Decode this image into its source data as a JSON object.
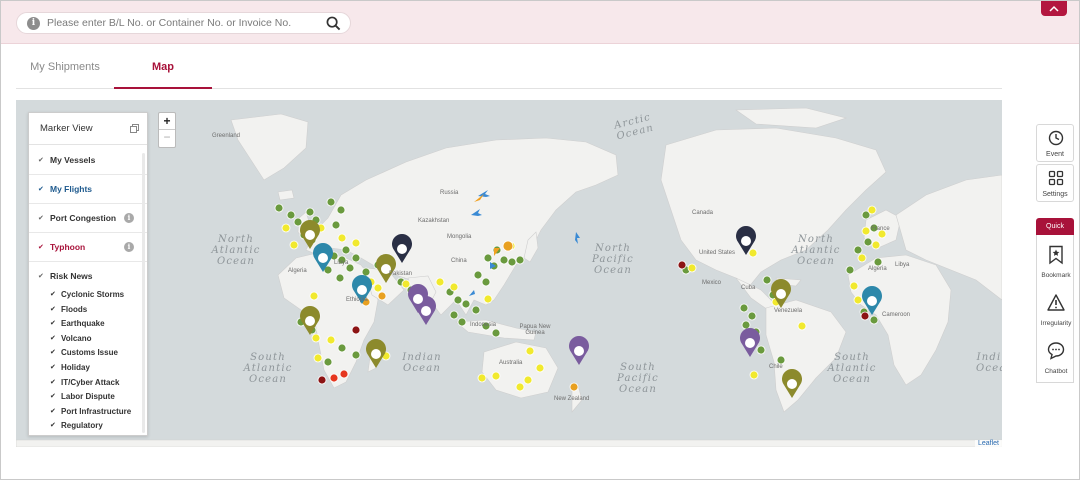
{
  "search": {
    "placeholder": "Please enter B/L No. or Container No. or Invoice No."
  },
  "tabs": [
    {
      "label": "My Shipments",
      "active": false
    },
    {
      "label": "Map",
      "active": true
    }
  ],
  "map": {
    "attribution": "Leaflet",
    "zoom_in": "+",
    "zoom_out": "−",
    "ocean_labels": {
      "arctic": "Arctic Ocean",
      "north_atlantic_w": "North Atlantic Ocean",
      "north_atlantic_e": "North Atlantic Ocean",
      "north_pacific": "North Pacific Ocean",
      "south_atlantic_w": "South Atlantic Ocean",
      "south_atlantic_e": "South Atlantic Ocean",
      "indian": "Indian Ocean",
      "south_pacific": "South Pacific Ocean",
      "indian_e": "Indi Ocea"
    },
    "land_labels": {
      "greenland": "Greenland",
      "russia": "Russia",
      "kazakhstan": "Kazakhstan",
      "mongolia": "Mongolia",
      "china": "China",
      "libya": "Libya",
      "algeria": "Algeria",
      "pakistan": "Pakistan",
      "ethiopia": "Ethiopia",
      "indonesia": "Indonesia",
      "papua": "Papua New Guinea",
      "australia": "Australia",
      "nz": "New Zealand",
      "canada": "Canada",
      "usa": "United States",
      "mexico": "Mexico",
      "cuba": "Cuba",
      "venezuela": "Venezuela",
      "chile": "Chile",
      "libya2": "Libya",
      "cameroon": "Cameroon",
      "algeria2": "Algeria",
      "france": "France"
    },
    "marker_colors": {
      "vessel": "#6a9a3e",
      "port_congestion": "#e9e12a",
      "typhoon": "#e8a020",
      "risk_red": "#8c1414",
      "flight": "#3a8ad4",
      "pin_olive": "#8c8a2c",
      "pin_navy": "#2a2f45",
      "pin_teal": "#2d88aa",
      "pin_purple": "#7a5c9e"
    }
  },
  "marker_view": {
    "title": "Marker View",
    "layers": [
      {
        "label": "My Vessels",
        "style": "normal",
        "info": false
      },
      {
        "label": "My Flights",
        "style": "blue",
        "info": false
      },
      {
        "label": "Port Congestion",
        "style": "normal",
        "info": true
      },
      {
        "label": "Typhoon",
        "style": "red",
        "info": true
      },
      {
        "label": "Risk News",
        "style": "normal",
        "info": false
      }
    ],
    "risk_news_items": [
      "Cyclonic Storms",
      "Floods",
      "Earthquake",
      "Volcano",
      "Customs Issue",
      "Holiday",
      "IT/Cyber Attack",
      "Labor Dispute",
      "Port Infrastructure",
      "Regulatory"
    ]
  },
  "side": {
    "event": "Event",
    "settings": "Settings",
    "quick": "Quick",
    "bookmark": "Bookmark",
    "irregularity": "Irregularity",
    "chatbot": "Chatbot"
  }
}
